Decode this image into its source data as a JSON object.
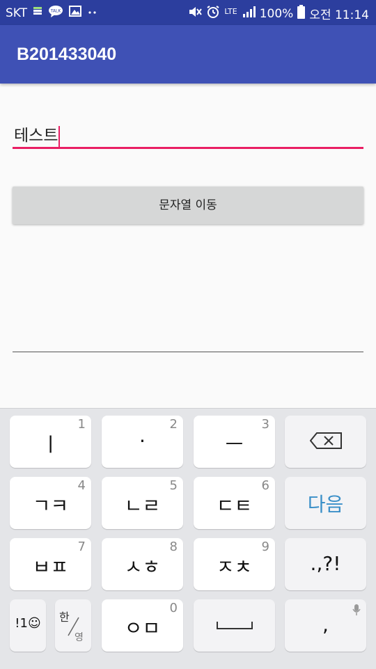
{
  "status_bar": {
    "carrier": "SKT",
    "talk_badge": "TALK",
    "network": "LTE",
    "battery": "100%",
    "time": "오전 11:14",
    "icons": [
      "sim-icon",
      "talk-icon",
      "image-icon",
      "dots-icon",
      "mute-icon",
      "alarm-icon",
      "signal-icon",
      "battery-icon"
    ]
  },
  "app_bar": {
    "title": "B201433040"
  },
  "editor": {
    "value": "테스트"
  },
  "action": {
    "button_label": "문자열 이동"
  },
  "keyboard": {
    "row1": [
      {
        "label": "ㅣ",
        "num": "1"
      },
      {
        "label": "·",
        "num": "2"
      },
      {
        "label": "ㅡ",
        "num": "3"
      }
    ],
    "row2": [
      {
        "label": "ㄱㅋ",
        "num": "4"
      },
      {
        "label": "ㄴㄹ",
        "num": "5"
      },
      {
        "label": "ㄷㅌ",
        "num": "6"
      }
    ],
    "row3": [
      {
        "label": "ㅂㅍ",
        "num": "7"
      },
      {
        "label": "ㅅㅎ",
        "num": "8"
      },
      {
        "label": "ㅈㅊ",
        "num": "9"
      }
    ],
    "row4": {
      "symbols": "!1☺",
      "lang_top": "한",
      "lang_bottom": "영",
      "o_label": "ㅇㅁ",
      "o_num": "0",
      "comma": ","
    },
    "next_label": "다음",
    "punct_label": ".,?!",
    "accent_color": "#3a8fc8"
  }
}
